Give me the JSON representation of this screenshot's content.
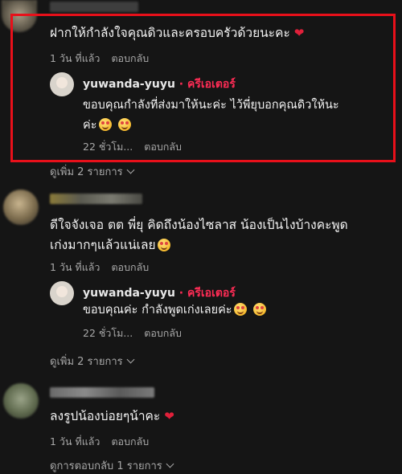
{
  "colors": {
    "background": "#151515",
    "creator": "#fe2c55",
    "highlight_box": "#e8101a",
    "meta": "#a8a8a8"
  },
  "comments": [
    {
      "text": "ฝากให้กำลังใจคุณดิวและครอบครัวด้วยนะคะ",
      "icon": "heart",
      "time": "1 วัน ที่แล้ว",
      "reply_action": "ตอบกลับ",
      "reply": {
        "user": "yuwanda-yuyu",
        "badge": "· ครีเอเตอร์",
        "text_line1": "ขอบคุณกำลังที่ส่งมาให้นะค่ะ ไว้พี่ยุบอกคุณดิวให้นะ",
        "text_line2": "ค่ะ",
        "time": "22 ชั่วโม...",
        "reply_action": "ตอบกลับ"
      },
      "more": "ดูเพิ่ม 2 รายการ"
    },
    {
      "text_line1": "ดีใจจังเจอ ตต พี่ยุ คิดถึงน้องไซลาส น้องเป็นไงบ้างคะพูด",
      "text_line2": "เก่งมากๆแล้วแน่เลย",
      "time": "1 วัน ที่แล้ว",
      "reply_action": "ตอบกลับ",
      "reply": {
        "user": "yuwanda-yuyu",
        "badge": "· ครีเอเตอร์",
        "text": "ขอบคุณค่ะ กำลังพูดเก่งเลยค่ะ",
        "time": "22 ชั่วโม...",
        "reply_action": "ตอบกลับ"
      },
      "more": "ดูเพิ่ม 2 รายการ"
    },
    {
      "text": "ลงรูปน้องบ่อยๆน้าคะ",
      "icon": "heart",
      "time": "1 วัน ที่แล้ว",
      "reply_action": "ตอบกลับ",
      "more": "ดูการตอบกลับ 1 รายการ"
    }
  ]
}
